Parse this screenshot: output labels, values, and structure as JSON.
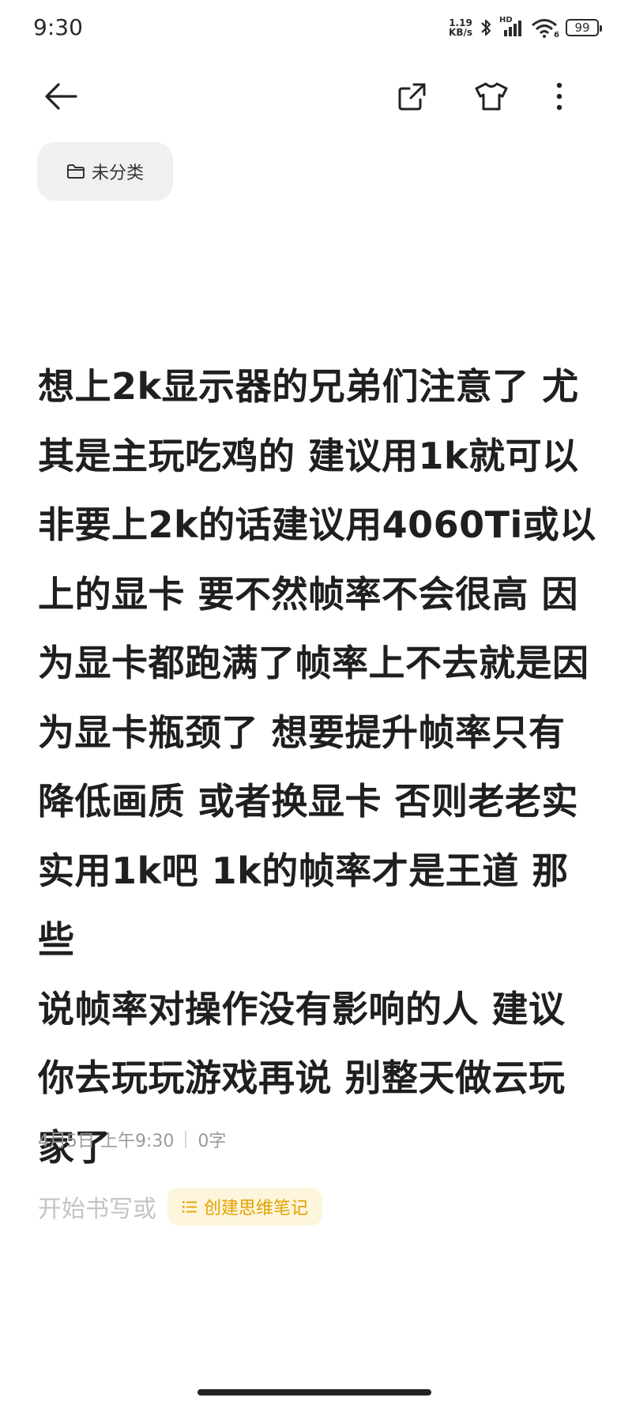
{
  "status_bar": {
    "time": "9:30",
    "net_speed_value": "1.19",
    "net_speed_unit": "KB/s",
    "signal_label": "HD",
    "wifi_label": "6",
    "battery": "99"
  },
  "toolbar": {
    "back_icon": "arrow-left-icon",
    "share_icon": "share-export-icon",
    "theme_icon": "tshirt-icon",
    "more_icon": "more-vertical-icon"
  },
  "category": {
    "label": "未分类",
    "icon": "folder-icon"
  },
  "note": {
    "lines": [
      "想上2k显示器的兄弟们注意了 尤",
      "其是主玩吃鸡的 建议用1k就可以",
      "非要上2k的话建议用4060Ti或以",
      "上的显卡 要不然帧率不会很高 因",
      "为显卡都跑满了帧率上不去就是因",
      "为显卡瓶颈了 想要提升帧率只有",
      "降低画质 或者换显卡 否则老老实",
      "实用1k吧 1k的帧率才是王道 那些",
      "说帧率对操作没有影响的人 建议",
      "你去玩玩游戏再说 别整天做云玩",
      "家了"
    ]
  },
  "meta": {
    "date": "4月5日 上午9:30",
    "word_count": "0字"
  },
  "compose": {
    "hint": "开始书写或",
    "mindmap_label": "创建思维笔记",
    "mindmap_icon": "list-icon"
  },
  "colors": {
    "accent": "#e2a200",
    "accent_bg": "#fdf5dc",
    "chip_bg": "#f0f0f0",
    "meta_text": "#9a9a9a"
  }
}
